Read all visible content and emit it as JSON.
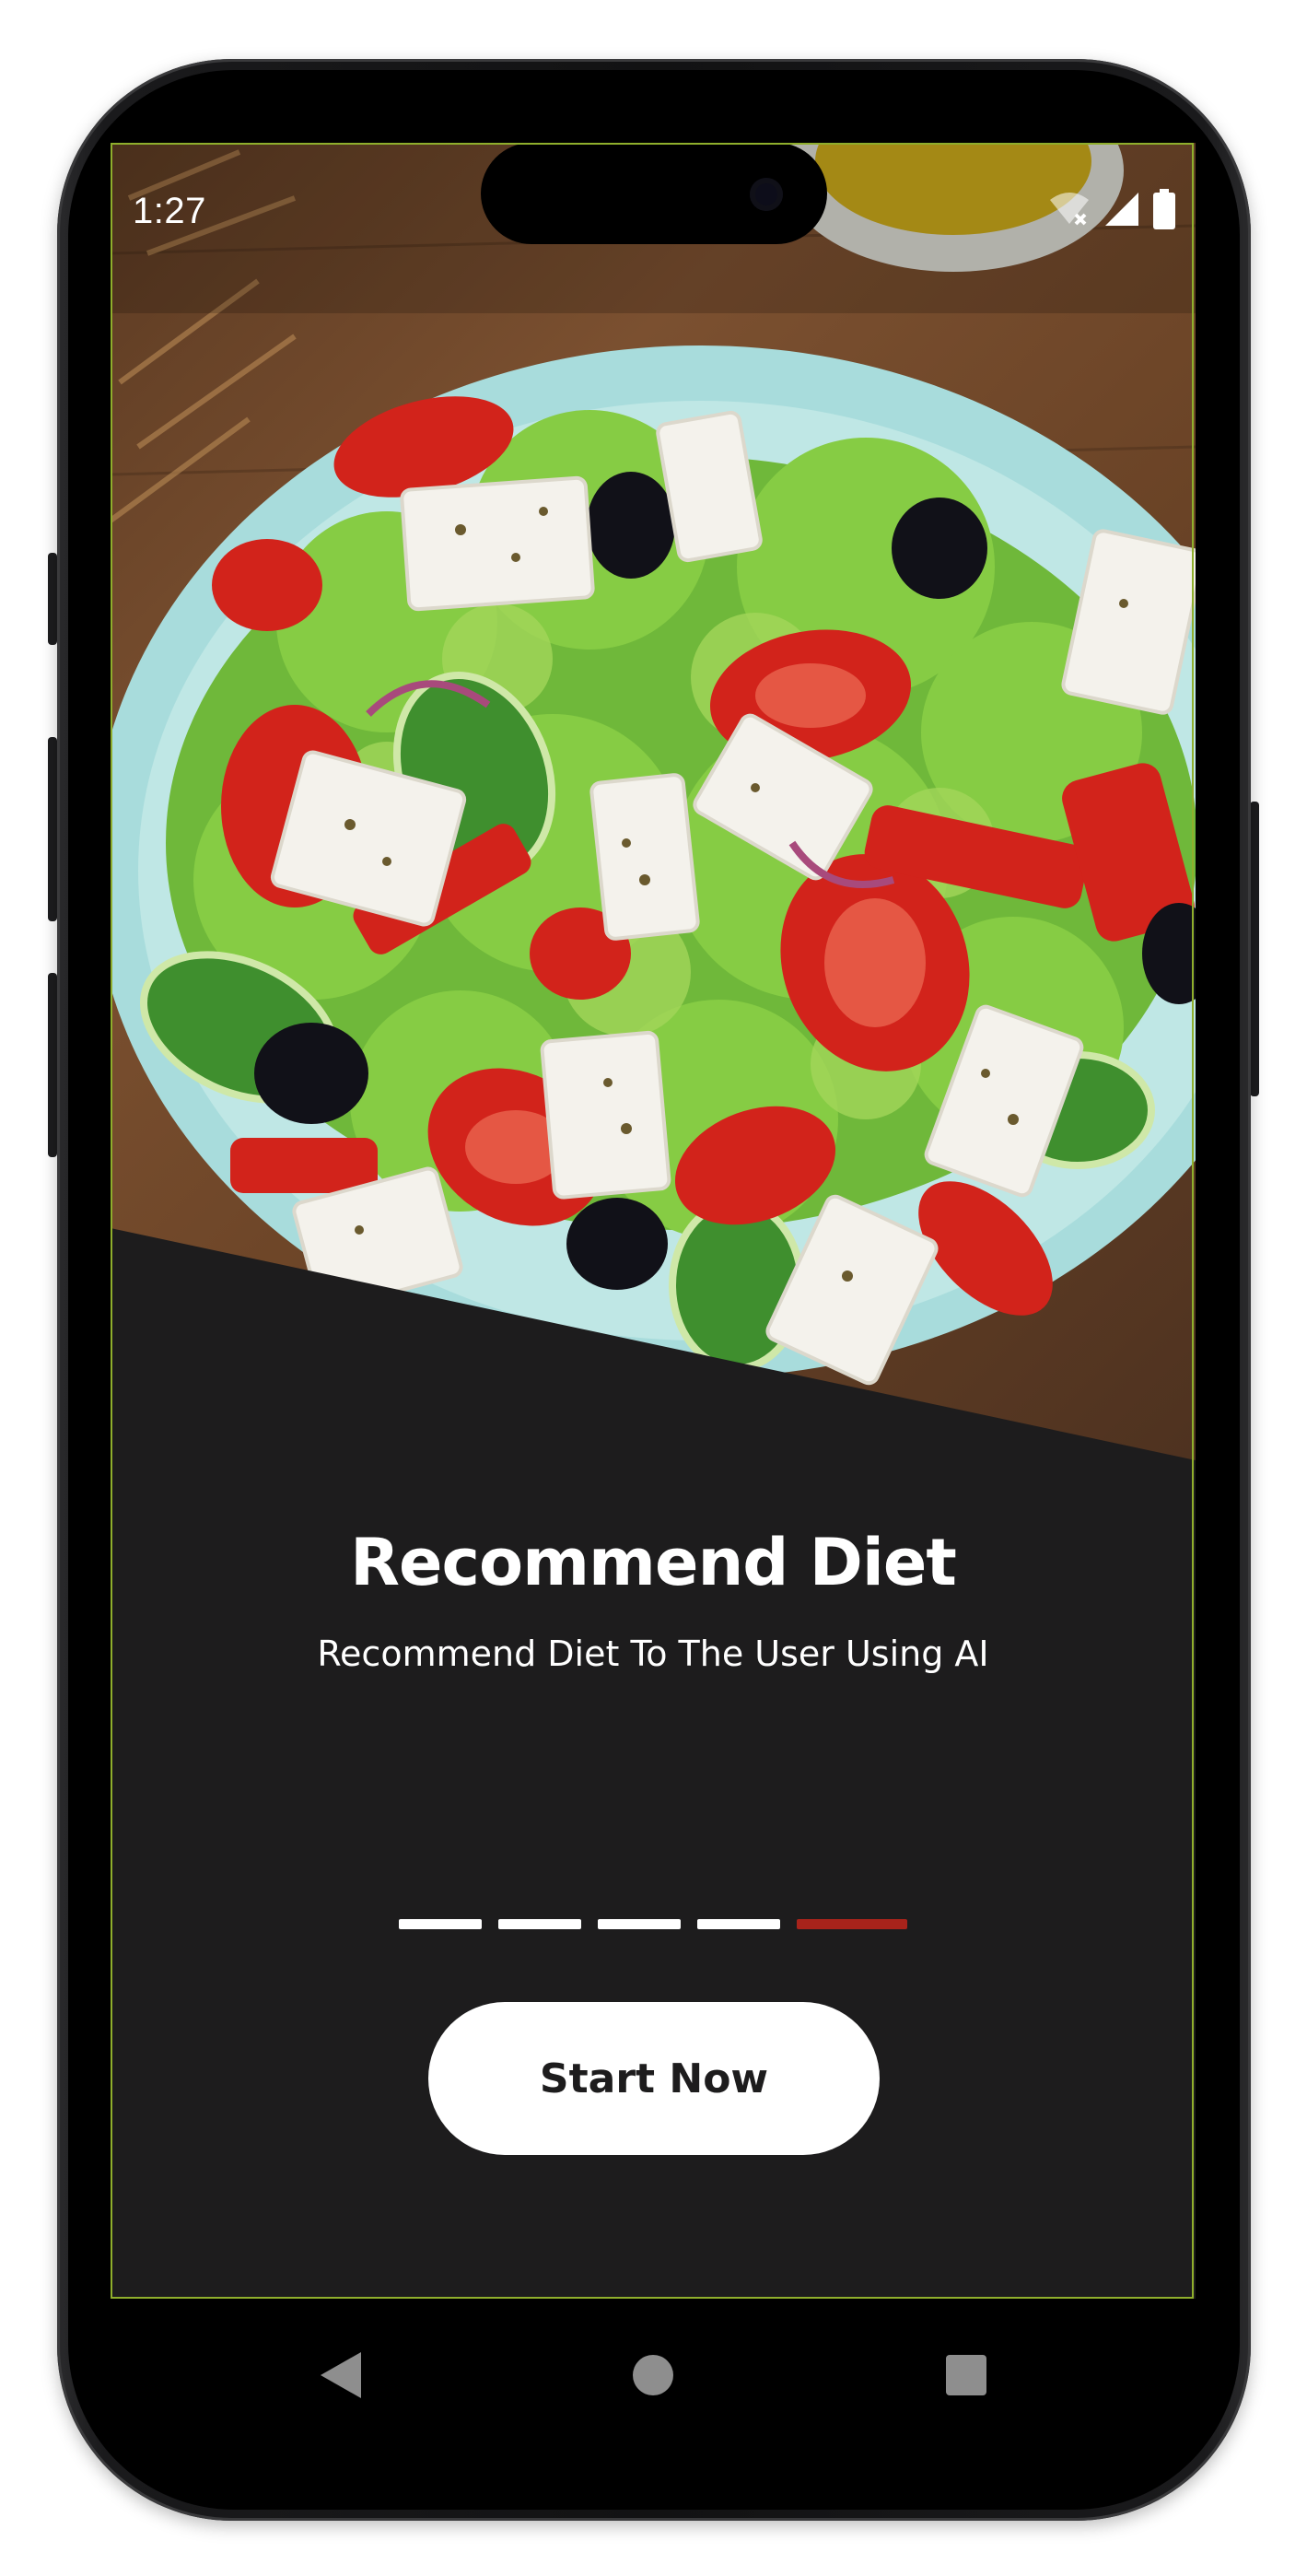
{
  "status_bar": {
    "time": "1:27",
    "icons": [
      "wifi-off-icon",
      "signal-icon",
      "battery-icon"
    ]
  },
  "onboarding": {
    "title": "Recommend Diet",
    "subtitle": "Recommend Diet To The User Using AI",
    "page_count": 5,
    "active_page": 5,
    "cta_label": "Start Now"
  },
  "navigation_bar": {
    "buttons": [
      "back-icon",
      "home-icon",
      "recents-icon"
    ]
  },
  "colors": {
    "panel_background": "#1d1c1d",
    "accent_active_page": "#a8231b",
    "frame_outline": "#8fae2c",
    "button_background": "#ffffff"
  }
}
